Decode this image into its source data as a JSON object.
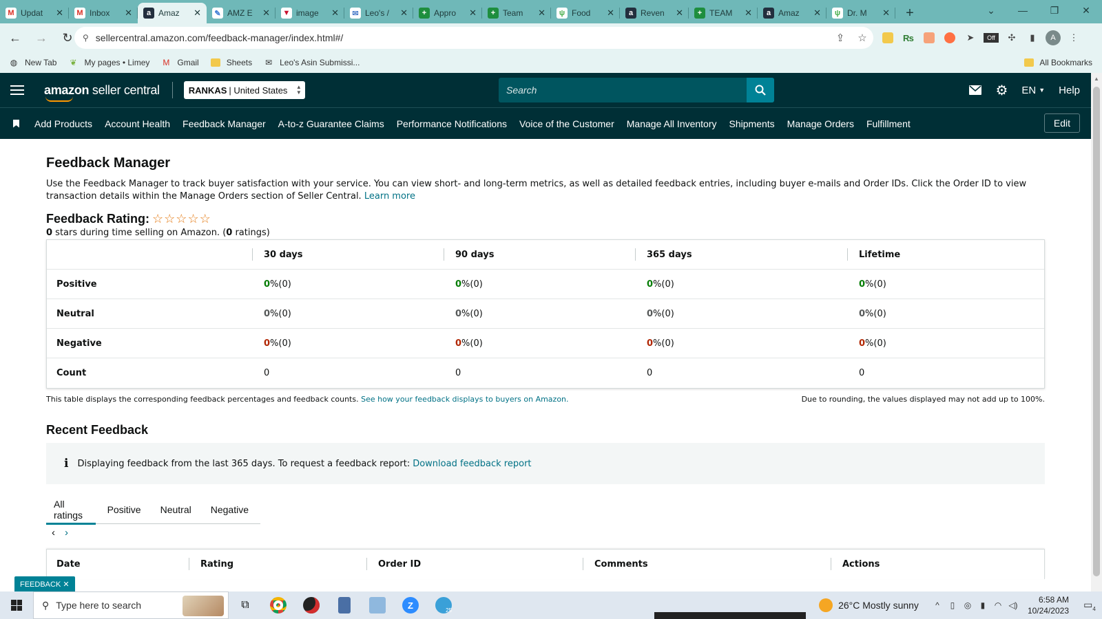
{
  "browser": {
    "tabs": [
      {
        "title": "Updat",
        "favicon": "gmail-icon",
        "active": false
      },
      {
        "title": "Inbox",
        "favicon": "gmail-icon",
        "active": false
      },
      {
        "title": "Amaz",
        "favicon": "amazon-icon",
        "active": true
      },
      {
        "title": "AMZ E",
        "favicon": "pen-icon",
        "active": false
      },
      {
        "title": "image",
        "favicon": "v-icon",
        "active": false
      },
      {
        "title": "Leo's /",
        "favicon": "doc-icon",
        "active": false
      },
      {
        "title": "Appro",
        "favicon": "sheets-icon",
        "active": false
      },
      {
        "title": "Team",
        "favicon": "sheets-icon",
        "active": false
      },
      {
        "title": "Food",
        "favicon": "leaf-icon",
        "active": false
      },
      {
        "title": "Reven",
        "favicon": "amazon-icon",
        "active": false
      },
      {
        "title": "TEAM",
        "favicon": "sheets-icon",
        "active": false
      },
      {
        "title": "Amaz",
        "favicon": "amazon-icon",
        "active": false
      },
      {
        "title": "Dr. M",
        "favicon": "leaf-icon",
        "active": false
      }
    ],
    "url": "sellercentral.amazon.com/feedback-manager/index.html#/",
    "bookmarks": [
      {
        "label": "New Tab",
        "icon": "globe-icon"
      },
      {
        "label": "My pages • Limey",
        "icon": "leaf-icon"
      },
      {
        "label": "Gmail",
        "icon": "gmail-icon"
      },
      {
        "label": "Sheets",
        "icon": "folder-icon"
      },
      {
        "label": "Leo's Asin Submissi...",
        "icon": "doc-icon"
      }
    ],
    "all_bookmarks": "All Bookmarks"
  },
  "header": {
    "logo_bold": "amazon",
    "logo_rest": " seller central",
    "market_store": "RANKAS",
    "market_region": "| United States",
    "search_placeholder": "Search",
    "lang": "EN",
    "help": "Help"
  },
  "nav": {
    "items": [
      "Add Products",
      "Account Health",
      "Feedback Manager",
      "A-to-z Guarantee Claims",
      "Performance Notifications",
      "Voice of the Customer",
      "Manage All Inventory",
      "Shipments",
      "Manage Orders",
      "Fulfillment"
    ],
    "edit": "Edit"
  },
  "page": {
    "title": "Feedback Manager",
    "description": "Use the Feedback Manager to track buyer satisfaction with your service. You can view short- and long-term metrics, as well as detailed feedback entries, including buyer e-mails and Order IDs. Click the Order ID to view transaction details within the Manage Orders section of Seller Central.",
    "learn_more": "Learn more",
    "rating_title": "Feedback Rating:",
    "stars": "☆☆☆☆☆",
    "stars_count": "0",
    "stars_text": " stars during time selling on Amazon. (",
    "ratings_count": "0",
    "ratings_text": " ratings)"
  },
  "metrics": {
    "columns": [
      "",
      "30 days",
      "90 days",
      "365 days",
      "Lifetime"
    ],
    "rows": [
      {
        "label": "Positive",
        "kind": "pos",
        "values": [
          {
            "n": "0",
            "s": " %(0)"
          },
          {
            "n": "0",
            "s": " %(0)"
          },
          {
            "n": "0",
            "s": " %(0)"
          },
          {
            "n": "0",
            "s": " %(0)"
          }
        ]
      },
      {
        "label": "Neutral",
        "kind": "neu",
        "values": [
          {
            "n": "0",
            "s": " %(0)"
          },
          {
            "n": "0",
            "s": " %(0)"
          },
          {
            "n": "0",
            "s": " %(0)"
          },
          {
            "n": "0",
            "s": " %(0)"
          }
        ]
      },
      {
        "label": "Negative",
        "kind": "neg",
        "values": [
          {
            "n": "0",
            "s": " %(0)"
          },
          {
            "n": "0",
            "s": " %(0)"
          },
          {
            "n": "0",
            "s": " %(0)"
          },
          {
            "n": "0",
            "s": " %(0)"
          }
        ]
      },
      {
        "label": "Count",
        "kind": "count",
        "values": [
          {
            "n": "",
            "s": "0"
          },
          {
            "n": "",
            "s": "0"
          },
          {
            "n": "",
            "s": "0"
          },
          {
            "n": "",
            "s": "0"
          }
        ]
      }
    ],
    "footnote": "This table displays the corresponding feedback percentages and feedback counts.",
    "footnote_link": "See how your feedback displays to buyers on Amazon.",
    "rounding_note": "Due to rounding, the values displayed may not add up to 100%."
  },
  "recent": {
    "title": "Recent Feedback",
    "info_text": "Displaying feedback from the last 365 days. To request a feedback report: ",
    "info_link": "Download feedback report",
    "tabs": [
      "All ratings",
      "Positive",
      "Neutral",
      "Negative"
    ],
    "active_tab": "All ratings",
    "columns": [
      "Date",
      "Rating",
      "Order ID",
      "Comments",
      "Actions"
    ]
  },
  "feedback_chip": "FEEDBACK ✕",
  "taskbar": {
    "search_placeholder": "Type here to search",
    "weather": "26°C  Mostly sunny",
    "time": "6:58 AM",
    "date": "10/24/2023",
    "notification_count": "4",
    "telegram_badge": "25"
  },
  "colors": {
    "header_bg": "#002f36",
    "accent": "#008296",
    "positive": "#067d06",
    "negative": "#b12704",
    "link": "#007185",
    "browser_chrome": "#6fb8b8"
  }
}
